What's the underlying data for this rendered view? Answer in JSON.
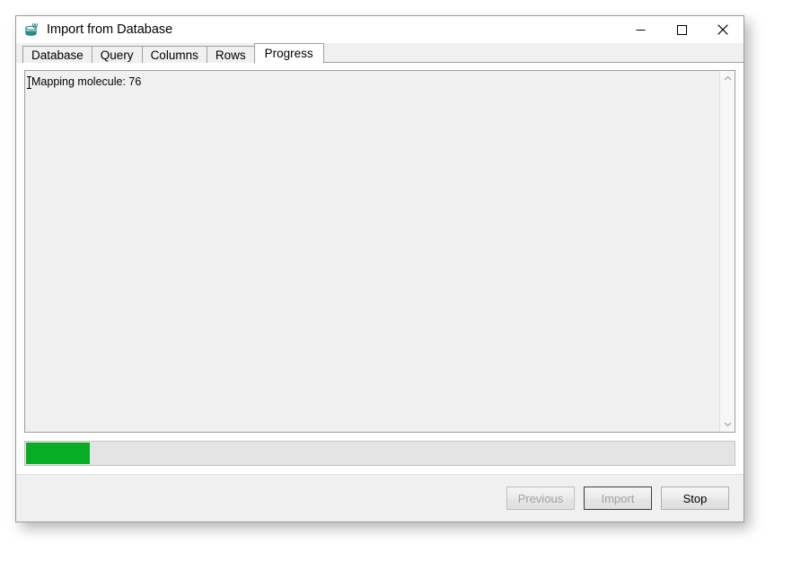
{
  "window": {
    "title": "Import from Database",
    "icon": "database-import-icon",
    "controls": {
      "minimize": "minimize-icon",
      "maximize": "maximize-icon",
      "close": "close-icon"
    }
  },
  "tabs": [
    {
      "label": "Database",
      "selected": false
    },
    {
      "label": "Query",
      "selected": false
    },
    {
      "label": "Columns",
      "selected": false
    },
    {
      "label": "Rows",
      "selected": false
    },
    {
      "label": "Progress",
      "selected": true
    }
  ],
  "log": {
    "lines": [
      "Mapping molecule: 76"
    ]
  },
  "scrollbar": {
    "up_arrow": "chevron-up-icon",
    "down_arrow": "chevron-down-icon"
  },
  "progress": {
    "percent": 9,
    "fill_color": "#07ae25",
    "track_color": "#e4e4e4"
  },
  "footer": {
    "buttons": [
      {
        "label": "Previous",
        "disabled": true,
        "default": false
      },
      {
        "label": "Import",
        "disabled": true,
        "default": true
      },
      {
        "label": "Stop",
        "disabled": false,
        "default": false
      }
    ]
  }
}
